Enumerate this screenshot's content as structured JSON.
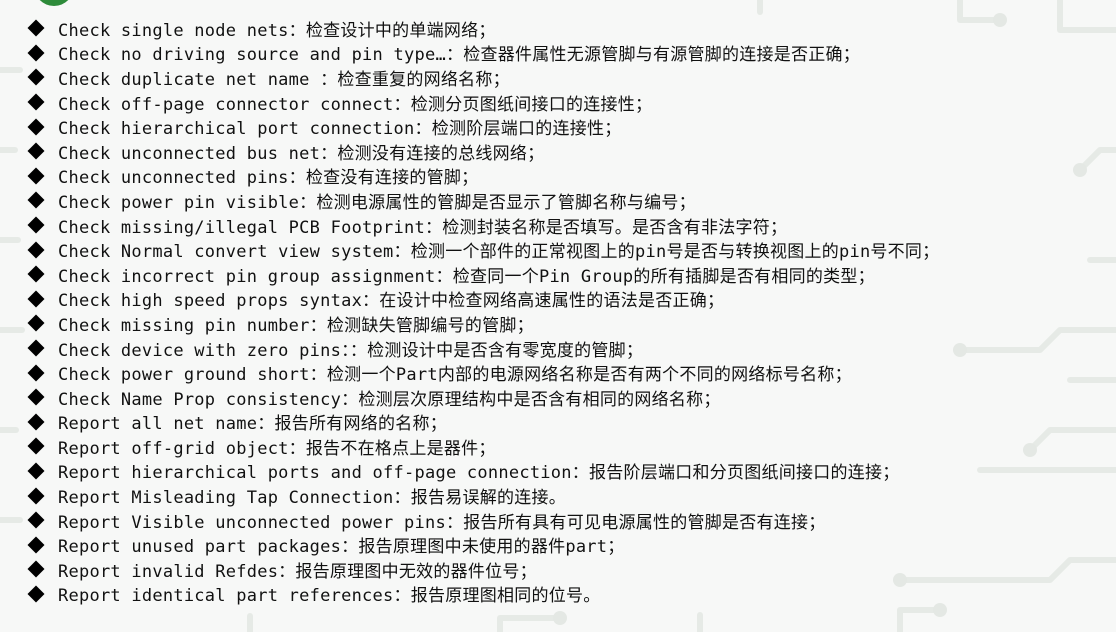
{
  "items": [
    "Check single node nets：检查设计中的单端网络；",
    "Check no driving source and pin type…：检查器件属性无源管脚与有源管脚的连接是否正确；",
    "Check duplicate net name ：检查重复的网络名称；",
    "Check off-page connector connect：检测分页图纸间接口的连接性；",
    "Check hierarchical port connection：检测阶层端口的连接性；",
    "Check unconnected bus net：检测没有连接的总线网络；",
    "Check unconnected pins：检查没有连接的管脚；",
    "Check power pin visible：检测电源属性的管脚是否显示了管脚名称与编号；",
    "Check missing/illegal PCB Footprint：检测封装名称是否填写。是否含有非法字符；",
    "Check Normal convert view system：检测一个部件的正常视图上的pin号是否与转换视图上的pin号不同；",
    "Check incorrect pin group assignment：检查同一个Pin Group的所有插脚是否有相同的类型；",
    "Check high speed props syntax：在设计中检查网络高速属性的语法是否正确；",
    "Check missing pin number：检测缺失管脚编号的管脚；",
    "Check device with zero pins：：检测设计中是否含有零宽度的管脚；",
    "Check power ground short：检测一个Part内部的电源网络名称是否有两个不同的网络标号名称；",
    "Check Name Prop  consistency：检测层次原理结构中是否含有相同的网络名称；",
    "Report all net name：报告所有网络的名称；",
    "Report off-grid object：报告不在格点上是器件；",
    "Report hierarchical ports and off-page connection：报告阶层端口和分页图纸间接口的连接；",
    "Report Misleading Tap Connection：报告易误解的连接。",
    "Report Visible unconnected power pins：报告所有具有可见电源属性的管脚是否有连接；",
    "Report unused part packages：报告原理图中未使用的器件part；",
    "Report invalid Refdes：报告原理图中无效的器件位号；",
    "Report identical part references：报告原理图相同的位号。"
  ]
}
